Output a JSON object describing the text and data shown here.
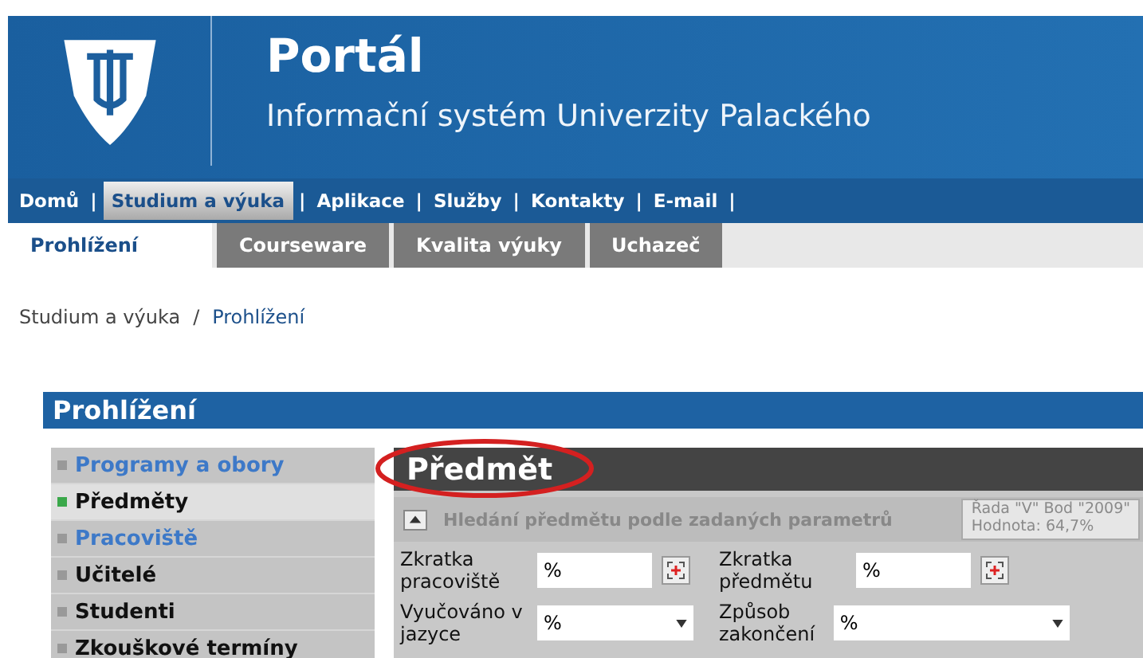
{
  "header": {
    "title": "Portál",
    "subtitle": "Informační systém Univerzity Palackého"
  },
  "nav": [
    {
      "label": "Domů",
      "selected": false,
      "separator": "|"
    },
    {
      "label": "Studium a výuka",
      "selected": true,
      "separator": "|"
    },
    {
      "label": "Aplikace",
      "selected": false,
      "separator": "|"
    },
    {
      "label": "Služby",
      "selected": false,
      "separator": "|"
    },
    {
      "label": "Kontakty",
      "selected": false,
      "separator": "|"
    },
    {
      "label": "E-mail",
      "selected": false,
      "separator": "|"
    }
  ],
  "tabs": [
    {
      "label": "Prohlížení",
      "selected": true
    },
    {
      "label": "Courseware",
      "selected": false
    },
    {
      "label": "Kvalita výuky",
      "selected": false
    },
    {
      "label": "Uchazeč",
      "selected": false
    }
  ],
  "breadcrumb": [
    {
      "label": "Studium a výuka",
      "kind": "plain"
    },
    {
      "label": "Prohlížení",
      "kind": "link",
      "separator": "/"
    }
  ],
  "panel": {
    "title": "Prohlížení"
  },
  "sidebar": {
    "items": [
      {
        "label": "Programy a obory",
        "kind": "link",
        "selected": false
      },
      {
        "label": "Předměty",
        "kind": "plain",
        "selected": true
      },
      {
        "label": "Pracoviště",
        "kind": "link",
        "selected": false
      },
      {
        "label": "Učitelé",
        "kind": "plain",
        "selected": false
      },
      {
        "label": "Studenti",
        "kind": "plain",
        "selected": false
      },
      {
        "label": "Zkouškové termíny",
        "kind": "plain",
        "selected": false
      }
    ]
  },
  "main": {
    "title": "Předmět",
    "section": "Hledání předmětu podle zadaných parametrů",
    "fields": [
      {
        "label": "Zkratka pracoviště",
        "value": "%",
        "kind": "picker"
      },
      {
        "label": "Zkratka předmětu",
        "value": "%",
        "kind": "picker"
      },
      {
        "label": "Vyučováno v jazyce",
        "value": "%",
        "kind": "select"
      },
      {
        "label": "Způsob zakončení",
        "value": "%",
        "kind": "select"
      }
    ]
  },
  "tooltip": {
    "lines": [
      "Řada \"V\" Bod \"2009\"",
      "Hodnota: 64,7%"
    ]
  }
}
